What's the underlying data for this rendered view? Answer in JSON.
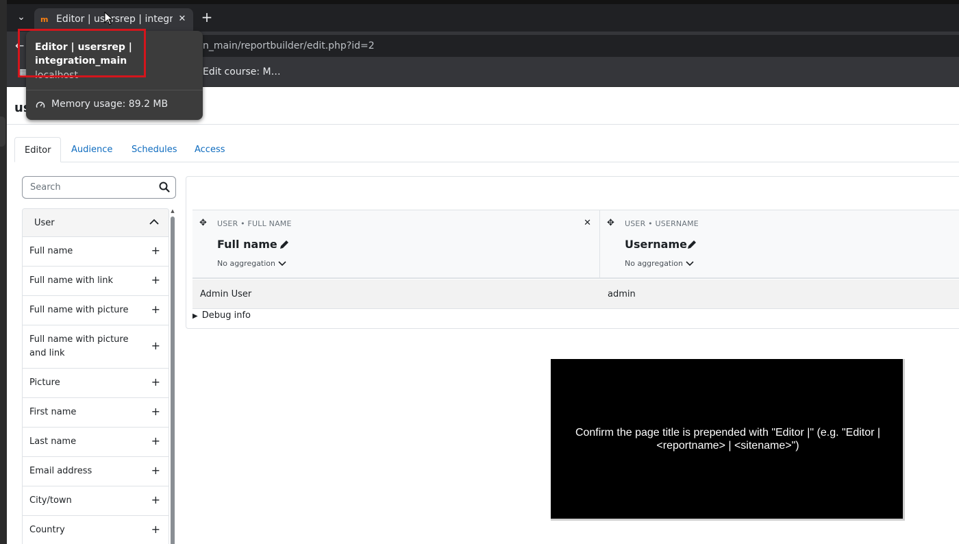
{
  "browser": {
    "tab": {
      "title": "Editor | usersrep | integration_main",
      "favicon": "moodle-favicon"
    },
    "url": "localhost/integration_main/reportbuilder/edit.php?id=2",
    "url_visible": "n_main/reportbuilder/edit.php?id=2",
    "bookmark": "Edit course: M…"
  },
  "hovercard": {
    "title": "Editor | usersrep | integration_main",
    "host": "localhost",
    "memory": "Memory usage: 89.2 MB"
  },
  "page": {
    "heading": "us",
    "tabs": [
      {
        "label": "Editor",
        "active": true
      },
      {
        "label": "Audience",
        "active": false
      },
      {
        "label": "Schedules",
        "active": false
      },
      {
        "label": "Access",
        "active": false
      }
    ]
  },
  "sidebar": {
    "search_placeholder": "Search",
    "section": "User",
    "items": [
      "Full name",
      "Full name with link",
      "Full name with picture",
      "Full name with picture and link",
      "Picture",
      "First name",
      "Last name",
      "Email address",
      "City/town",
      "Country"
    ]
  },
  "report": {
    "columns": [
      {
        "category": "USER • FULL NAME",
        "name": "Full name",
        "aggregation": "No aggregation"
      },
      {
        "category": "USER • USERNAME",
        "name": "Username",
        "aggregation": "No aggregation"
      }
    ],
    "rows": [
      [
        "Admin User",
        "admin"
      ]
    ],
    "debug_label": "Debug info"
  },
  "overlay": {
    "message": "Confirm the page title is prepended with \"Editor |\" (e.g. \"Editor | <reportname> | <sitename>\")"
  },
  "colors": {
    "link": "#0f6cbf",
    "highlight": "#d4151c",
    "brand": "#f98012"
  }
}
